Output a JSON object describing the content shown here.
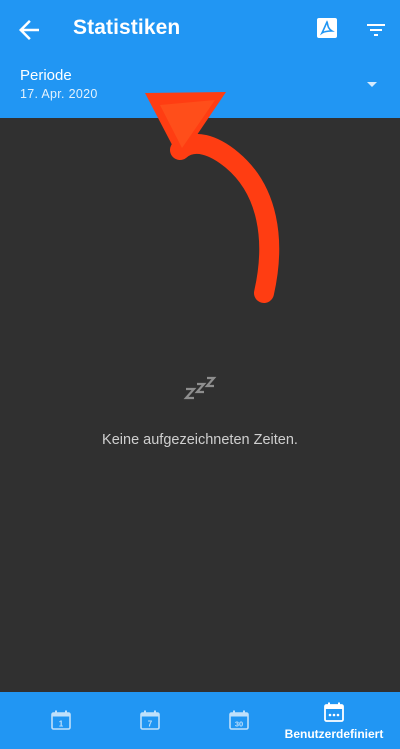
{
  "appbar": {
    "title": "Statistiken",
    "back_icon": "arrow-back-icon",
    "pdf_icon": "pdf-icon",
    "filter_icon": "filter-icon"
  },
  "period": {
    "label": "Periode",
    "value": "17. Apr. 2020",
    "dropdown_icon": "arrow-drop-down-icon"
  },
  "empty_state": {
    "icon": "sleep-zzz-icon",
    "message": "Keine aufgezeichneten Zeiten."
  },
  "bottom_nav": {
    "items": [
      {
        "icon": "calendar-day-icon",
        "day": "1",
        "label": ""
      },
      {
        "icon": "calendar-week-icon",
        "day": "7",
        "label": ""
      },
      {
        "icon": "calendar-month-icon",
        "day": "30",
        "label": ""
      },
      {
        "icon": "calendar-custom-icon",
        "day": "",
        "label": "Benutzerdefiniert"
      }
    ],
    "selected": "Benutzerdefiniert"
  },
  "colors": {
    "primary": "#2196F3",
    "background": "#303030",
    "annotation_arrow": "#FF3D12"
  }
}
